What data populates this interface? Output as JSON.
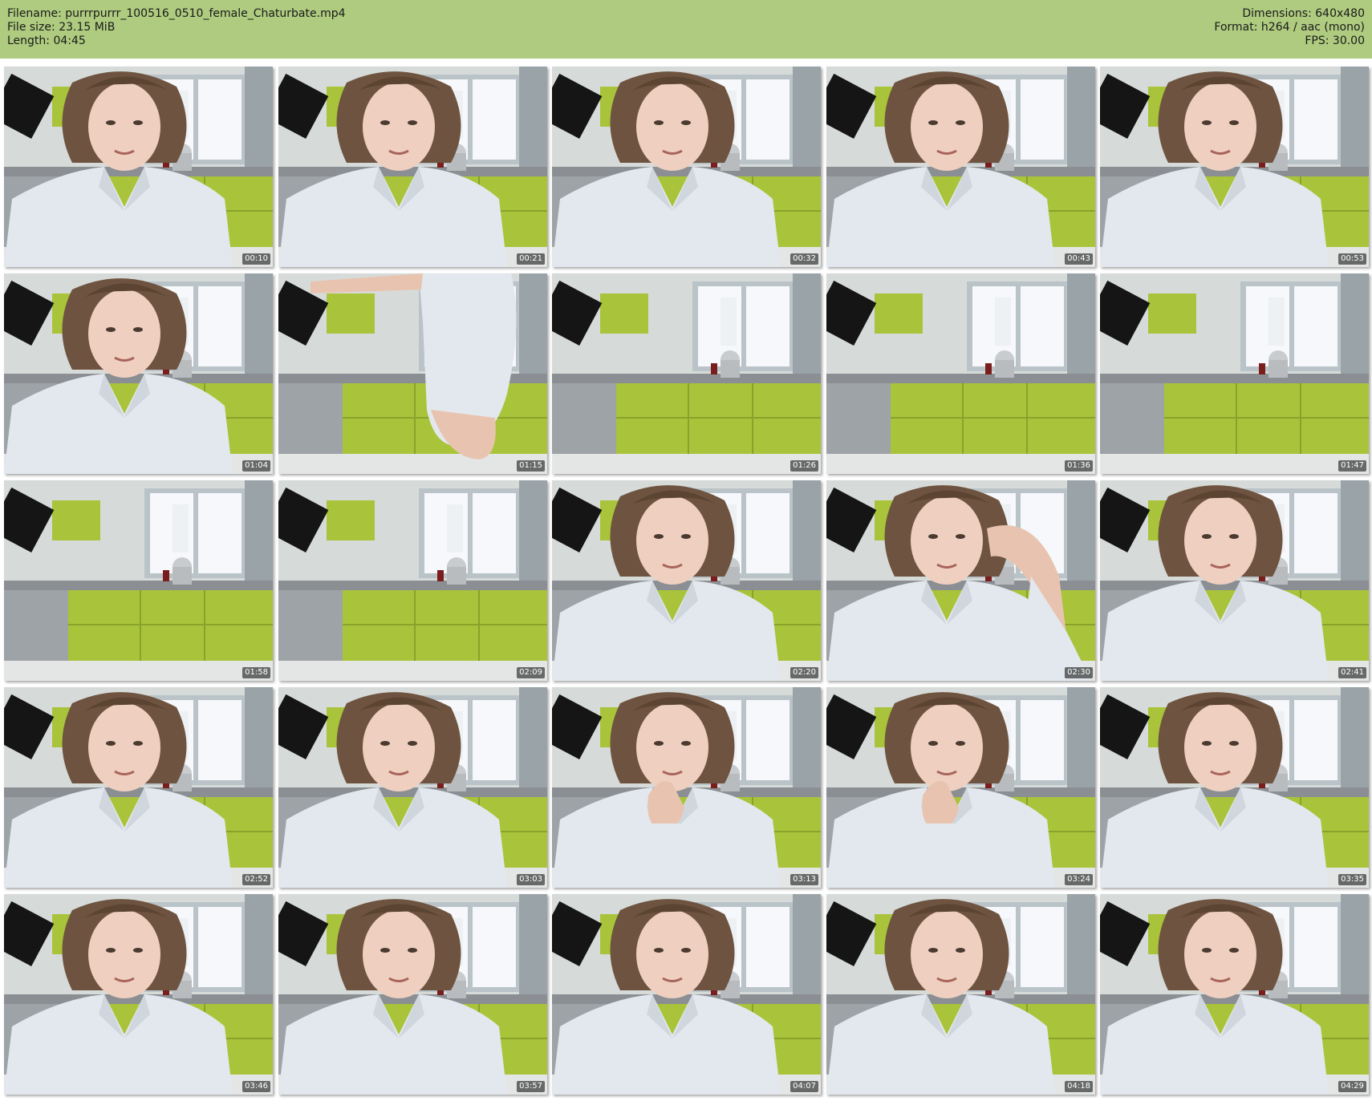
{
  "header": {
    "filename": "Filename: purrrpurrr_100516_0510_female_Chaturbate.mp4",
    "filesize": "File size: 23.15 MiB",
    "length": "Length: 04:45",
    "dimensions": "Dimensions: 640x480",
    "format": "Format: h264 / aac (mono)",
    "fps": "FPS: 30.00"
  },
  "colors": {
    "header_bg": "#aecb7f",
    "cabinet_green": "#a9c43a",
    "shirt": "#e3e8ee",
    "window": "#f6f8fb"
  },
  "frames": [
    {
      "time": "00:10",
      "scene": "person"
    },
    {
      "time": "00:21",
      "scene": "person"
    },
    {
      "time": "00:32",
      "scene": "person"
    },
    {
      "time": "00:43",
      "scene": "person"
    },
    {
      "time": "00:53",
      "scene": "person"
    },
    {
      "time": "01:04",
      "scene": "person"
    },
    {
      "time": "01:15",
      "scene": "kitchen-walkaway"
    },
    {
      "time": "01:26",
      "scene": "kitchen"
    },
    {
      "time": "01:36",
      "scene": "kitchen"
    },
    {
      "time": "01:47",
      "scene": "kitchen"
    },
    {
      "time": "01:58",
      "scene": "kitchen"
    },
    {
      "time": "02:09",
      "scene": "kitchen"
    },
    {
      "time": "02:20",
      "scene": "person"
    },
    {
      "time": "02:30",
      "scene": "person-hand-hair"
    },
    {
      "time": "02:41",
      "scene": "person"
    },
    {
      "time": "02:52",
      "scene": "person"
    },
    {
      "time": "03:03",
      "scene": "person"
    },
    {
      "time": "03:13",
      "scene": "person-hand-mouth"
    },
    {
      "time": "03:24",
      "scene": "person-hand-mouth"
    },
    {
      "time": "03:35",
      "scene": "person"
    },
    {
      "time": "03:46",
      "scene": "person"
    },
    {
      "time": "03:57",
      "scene": "person"
    },
    {
      "time": "04:07",
      "scene": "person"
    },
    {
      "time": "04:18",
      "scene": "person"
    },
    {
      "time": "04:29",
      "scene": "person"
    }
  ]
}
